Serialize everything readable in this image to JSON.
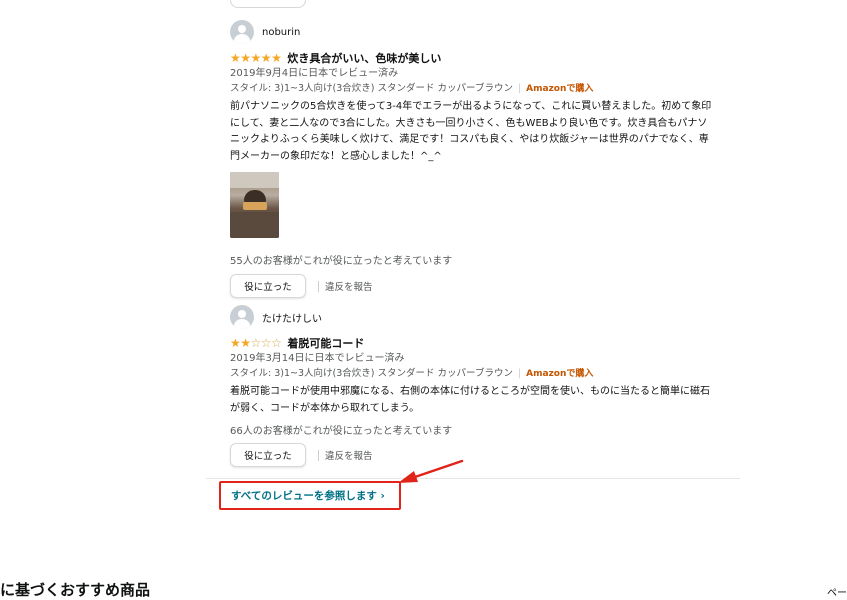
{
  "reviews": [
    {
      "username": "noburin",
      "rating": 5,
      "title": "炊き具合がいい、色味が美しい",
      "date": "2019年9月4日に日本でレビュー済み",
      "style": "スタイル: 3)1~3人向け(3合炊き) スタンダード カッパーブラウン",
      "verified": "Amazonで購入",
      "body_lines": [
        "前パナソニックの5合炊きを使って3-4年でエラーが出るようになって、これに買い替えました。初めて象印",
        "にして、妻と二人なので3合にした。大きさも一回り小さく、色もWEBより良い色です。炊き具合もパナソ",
        "ニックよりふっくら美味しく炊けて、満足です！コスパも良く、やはり炊飯ジャーは世界のパナでなく、専",
        "門メーカーの象印だな！と感心しました！^_^"
      ],
      "helpful_count": "55人のお客様がこれが役に立ったと考えています",
      "helpful_button": "役に立った",
      "report_label": "違反を報告"
    },
    {
      "username": "たけたけしい",
      "rating": 2,
      "title": "着脱可能コード",
      "date": "2019年3月14日に日本でレビュー済み",
      "style": "スタイル: 3)1~3人向け(3合炊き) スタンダード カッパーブラウン",
      "verified": "Amazonで購入",
      "body_lines": [
        "着脱可能コードが使用中邪魔になる、右側の本体に付けるところが空間を使い、ものに当たると簡単に磁石",
        "が弱く、コードが本体から取れてしまう。"
      ],
      "helpful_count": "66人のお客様がこれが役に立ったと考えています",
      "helpful_button": "役に立った",
      "report_label": "違反を報告"
    }
  ],
  "all_reviews_link": "すべてのレビューを参照します ›",
  "section_heading": "に基づくおすすめ商品",
  "page_indicator": "ペー",
  "icons": {
    "avatar": "avatar-icon",
    "star": "star-icon",
    "arrow": "arrow-annotation"
  },
  "colors": {
    "star": "#f5a623",
    "link": "#007185",
    "verified": "#c45500",
    "highlight": "#e2231a"
  }
}
